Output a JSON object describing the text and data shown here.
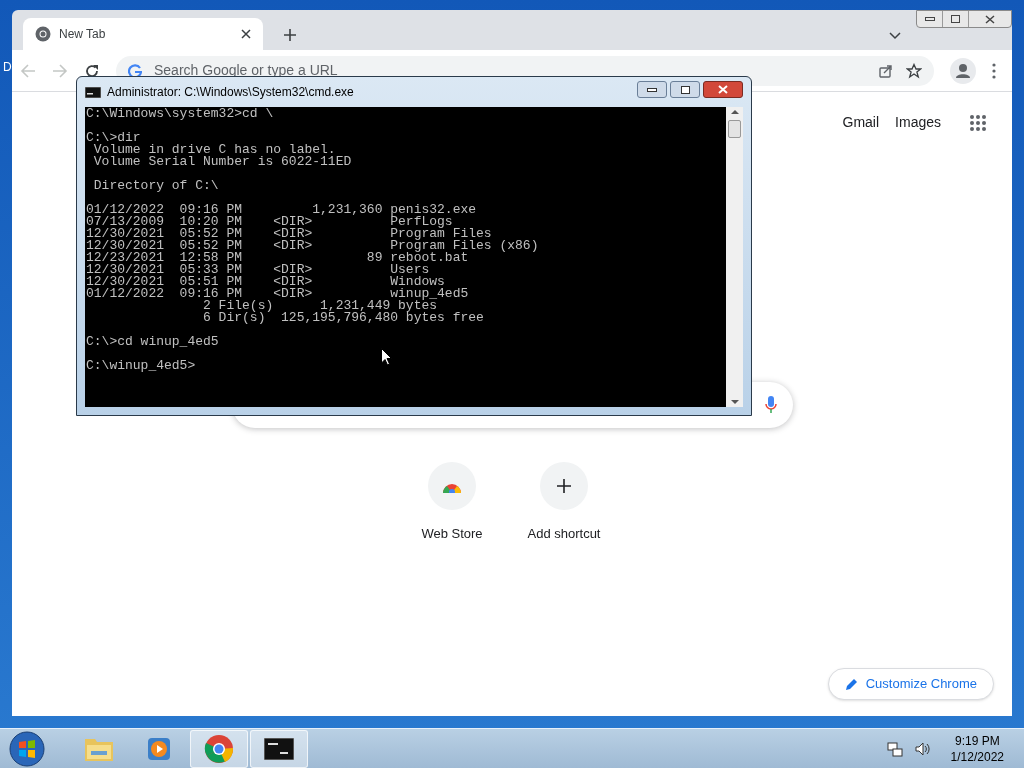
{
  "desktop": {
    "icon_label": "D"
  },
  "browser": {
    "tabs": [
      {
        "title": "New Tab",
        "selected": true
      }
    ],
    "omnibox": {
      "placeholder": "Search Google or type a URL"
    },
    "header_links": [
      "Gmail",
      "Images"
    ],
    "shortcuts": [
      {
        "kind": "webstore",
        "label": "Web Store"
      },
      {
        "kind": "add",
        "label": "Add shortcut"
      }
    ],
    "customize_button": "Customize Chrome"
  },
  "console": {
    "title": "Administrator: C:\\Windows\\System32\\cmd.exe",
    "blocks": [
      [
        "C:\\Windows\\system32>cd \\"
      ],
      [
        "C:\\>dir",
        " Volume in drive C has no label.",
        " Volume Serial Number is 6022-11ED"
      ],
      [
        " Directory of C:\\"
      ],
      [
        "01/12/2022  09:16 PM         1,231,360 penis32.exe",
        "07/13/2009  10:20 PM    <DIR>          PerfLogs",
        "12/30/2021  05:52 PM    <DIR>          Program Files",
        "12/30/2021  05:52 PM    <DIR>          Program Files (x86)",
        "12/23/2021  12:58 PM                89 reboot.bat",
        "12/30/2021  05:33 PM    <DIR>          Users",
        "12/30/2021  05:51 PM    <DIR>          Windows",
        "01/12/2022  09:16 PM    <DIR>          winup_4ed5",
        "               2 File(s)      1,231,449 bytes",
        "               6 Dir(s)  125,195,796,480 bytes free"
      ],
      [
        "C:\\>cd winup_4ed5"
      ],
      [
        "C:\\winup_4ed5>"
      ]
    ]
  },
  "taskbar": {
    "apps": [
      {
        "kind": "folder",
        "active": false
      },
      {
        "kind": "media",
        "active": false
      },
      {
        "kind": "chrome",
        "active": true
      },
      {
        "kind": "cmd",
        "active": true
      }
    ],
    "time": "9:19 PM",
    "date": "1/12/2022"
  }
}
